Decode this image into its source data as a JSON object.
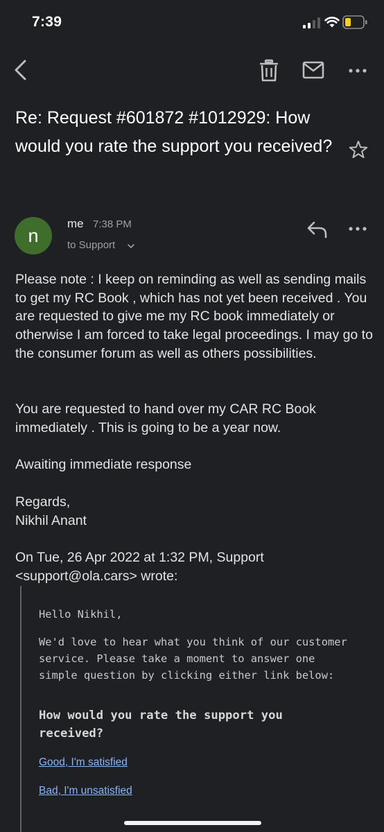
{
  "status_bar": {
    "time": "7:39"
  },
  "app_bar": {
    "icons": [
      "back-arrow-icon",
      "trash-icon",
      "mail-icon",
      "more-vert-icon"
    ]
  },
  "email": {
    "subject": "Re: Request #601872 #1012929: How would you rate the support you received?",
    "sender": {
      "avatar_letter": "n",
      "avatar_color": "#3f6e2c",
      "name": "me",
      "time": "7:38 PM",
      "recipient": "to Support"
    },
    "body": {
      "paragraph_1": "Please note : I keep on reminding as well as sending mails to get my RC Book , which has not yet been received . You are requested to give me my RC book immediately or otherwise I am forced to take legal proceedings. I may go to the consumer forum as well as others possibilities.",
      "paragraph_2": "You are requested to hand over my CAR RC Book immediately . This is going to be a year now.",
      "paragraph_3": "Awaiting immediate response",
      "signature_line_1": "Regards,",
      "signature_line_2": "Nikhil Anant"
    },
    "quote_header_line_1": "On Tue, 26 Apr 2022 at 1:32 PM, Support",
    "quote_header_line_2": "<support@ola.cars> wrote:",
    "quoted": {
      "greeting": "Hello Nikhil,",
      "intro": "We'd love to hear what you think of our customer service. Please take a moment to answer one simple question by clicking either link below:",
      "question": "How would you rate the support you received?",
      "link_good": "Good, I'm satisfied",
      "link_bad": "Bad, I'm unsatisfied"
    }
  },
  "colors": {
    "background": "#1f2023",
    "link": "#8ab4f8",
    "battery": "#f5cf1d"
  }
}
